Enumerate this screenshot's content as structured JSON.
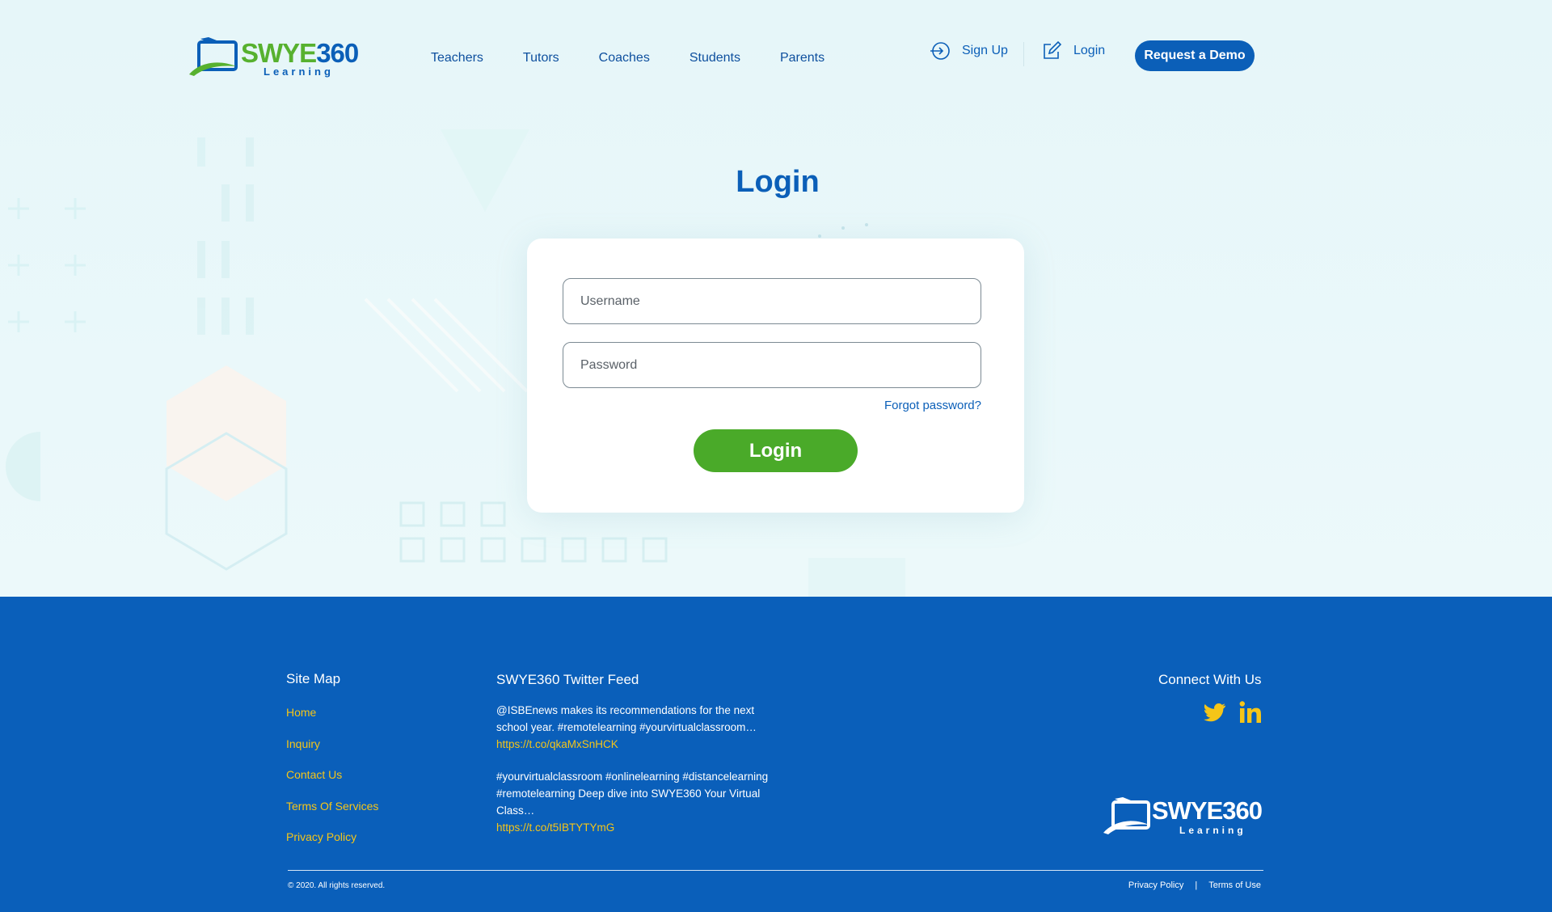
{
  "brand": {
    "logo_main_a": "SWYE",
    "logo_main_b": "360",
    "logo_sub": "Learning"
  },
  "nav": [
    {
      "label": "Teachers"
    },
    {
      "label": "Tutors"
    },
    {
      "label": "Coaches"
    },
    {
      "label": "Students"
    },
    {
      "label": "Parents"
    }
  ],
  "header_actions": {
    "signup_label": "Sign Up",
    "signup_icon": "sign-in-arrow-icon",
    "login_label": "Login",
    "login_icon": "edit-icon",
    "demo_label": "Request a Demo"
  },
  "login": {
    "title": "Login",
    "username_placeholder": "Username",
    "username_value": "",
    "password_placeholder": "Password",
    "password_value": "",
    "forgot_label": "Forgot password?",
    "submit_label": "Login"
  },
  "footer": {
    "sitemap_heading": "Site Map",
    "sitemap_links": [
      {
        "label": "Home"
      },
      {
        "label": "Inquiry"
      },
      {
        "label": "Contact Us"
      },
      {
        "label": "Terms Of Services"
      },
      {
        "label": "Privacy Policy"
      }
    ],
    "twitter_heading": "SWYE360 Twitter Feed",
    "tweets": [
      {
        "text": "@ISBEnews makes its recommendations for the next school year. #remotelearning #yourvirtualclassroom…",
        "link": "https://t.co/qkaMxSnHCK"
      },
      {
        "text": "#yourvirtualclassroom #onlinelearning #distancelearning #remotelearning Deep dive into SWYE360 Your Virtual Class…",
        "link": "https://t.co/t5IBTYTYmG"
      }
    ],
    "connect_heading": "Connect With Us",
    "social": [
      {
        "icon": "twitter-icon"
      },
      {
        "icon": "linkedin-icon"
      }
    ],
    "copyright": "© 2020. All rights reserved.",
    "legal_privacy": "Privacy Policy",
    "legal_sep": "|",
    "legal_terms": "Terms of Use"
  },
  "colors": {
    "primary_blue": "#0b5fb8",
    "brand_green": "#4aaa29",
    "link_yellow": "#f5c518",
    "page_bg": "#e8f6f8"
  }
}
